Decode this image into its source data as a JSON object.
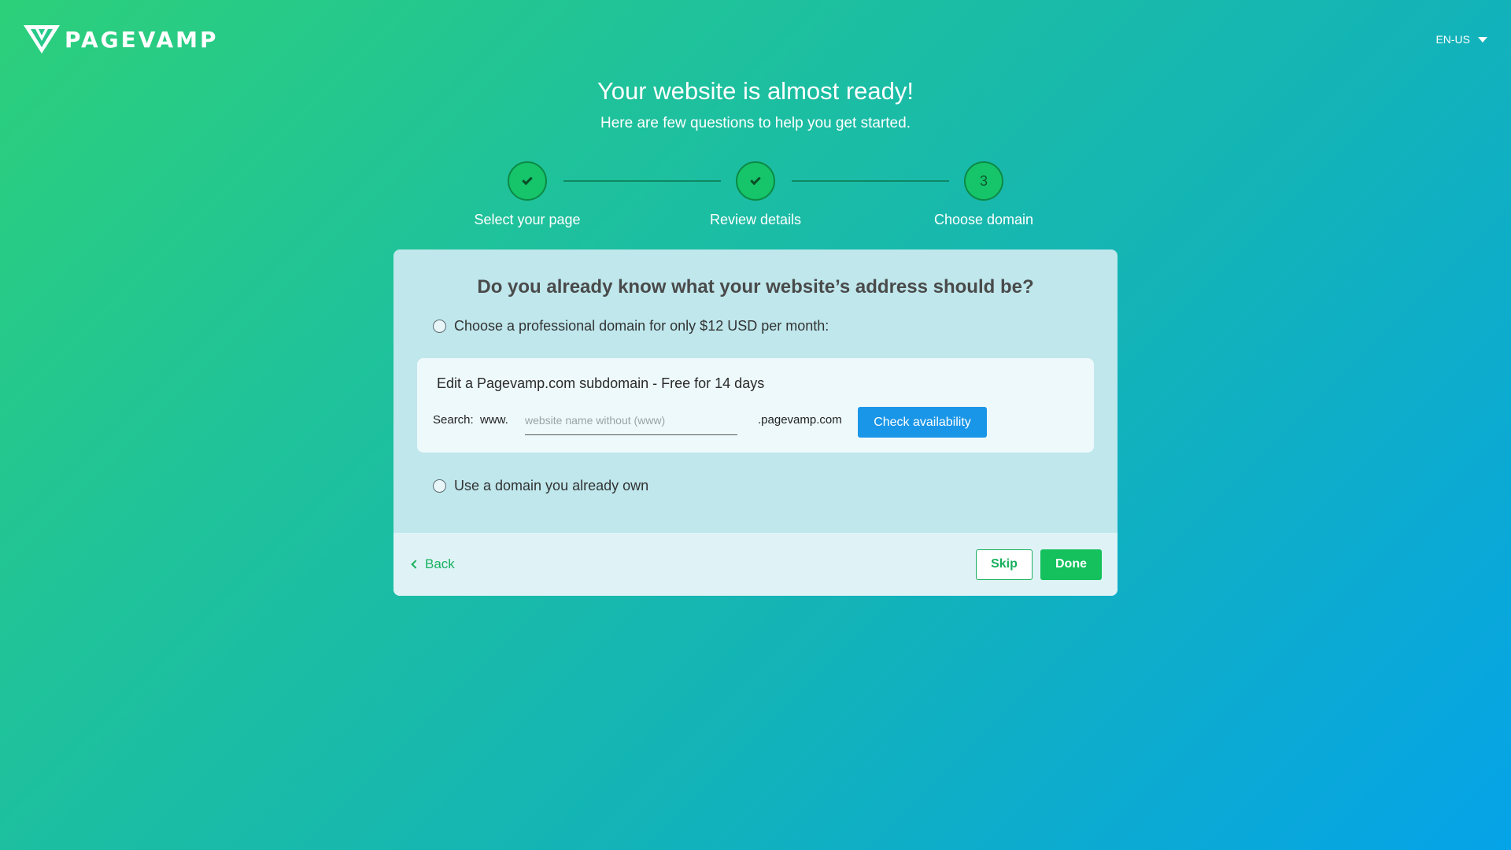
{
  "header": {
    "logo_text": "PAGEVAMP",
    "language": "EN-US"
  },
  "heading": {
    "title": "Your website is almost ready!",
    "subtitle": "Here are few questions to help you get started."
  },
  "stepper": {
    "steps": [
      {
        "label": "Select your page",
        "state": "completed",
        "icon": "check-icon"
      },
      {
        "label": "Review details",
        "state": "completed",
        "icon": "check-icon"
      },
      {
        "label": "Choose domain",
        "state": "current",
        "number": "3"
      }
    ]
  },
  "card": {
    "question": "Do you already know what your website’s address should be?",
    "option_professional": "Choose a professional domain for only $12 USD per month:",
    "subdomain": {
      "title": "Edit a Pagevamp.com subdomain - Free for 14 days",
      "search_label": "Search:",
      "www_label": "www.",
      "input_value": "",
      "input_placeholder": "website name without (www)",
      "suffix": ".pagevamp.com",
      "check_button": "Check availability"
    },
    "option_own": "Use a domain you already own"
  },
  "footer": {
    "back_label": "Back",
    "skip_label": "Skip",
    "done_label": "Done"
  },
  "colors": {
    "accent_green": "#14c15c",
    "accent_blue": "#1a96e8",
    "card_bg": "#bfe7ec"
  }
}
